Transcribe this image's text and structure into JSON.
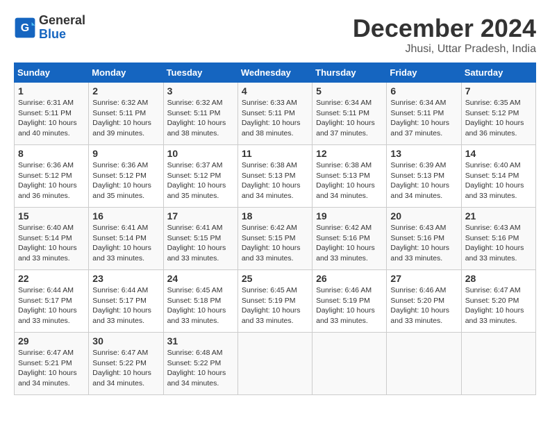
{
  "header": {
    "logo_line1": "General",
    "logo_line2": "Blue",
    "month": "December 2024",
    "location": "Jhusi, Uttar Pradesh, India"
  },
  "weekdays": [
    "Sunday",
    "Monday",
    "Tuesday",
    "Wednesday",
    "Thursday",
    "Friday",
    "Saturday"
  ],
  "weeks": [
    [
      {
        "day": "1",
        "info": "Sunrise: 6:31 AM\nSunset: 5:11 PM\nDaylight: 10 hours\nand 40 minutes."
      },
      {
        "day": "2",
        "info": "Sunrise: 6:32 AM\nSunset: 5:11 PM\nDaylight: 10 hours\nand 39 minutes."
      },
      {
        "day": "3",
        "info": "Sunrise: 6:32 AM\nSunset: 5:11 PM\nDaylight: 10 hours\nand 38 minutes."
      },
      {
        "day": "4",
        "info": "Sunrise: 6:33 AM\nSunset: 5:11 PM\nDaylight: 10 hours\nand 38 minutes."
      },
      {
        "day": "5",
        "info": "Sunrise: 6:34 AM\nSunset: 5:11 PM\nDaylight: 10 hours\nand 37 minutes."
      },
      {
        "day": "6",
        "info": "Sunrise: 6:34 AM\nSunset: 5:11 PM\nDaylight: 10 hours\nand 37 minutes."
      },
      {
        "day": "7",
        "info": "Sunrise: 6:35 AM\nSunset: 5:12 PM\nDaylight: 10 hours\nand 36 minutes."
      }
    ],
    [
      {
        "day": "8",
        "info": "Sunrise: 6:36 AM\nSunset: 5:12 PM\nDaylight: 10 hours\nand 36 minutes."
      },
      {
        "day": "9",
        "info": "Sunrise: 6:36 AM\nSunset: 5:12 PM\nDaylight: 10 hours\nand 35 minutes."
      },
      {
        "day": "10",
        "info": "Sunrise: 6:37 AM\nSunset: 5:12 PM\nDaylight: 10 hours\nand 35 minutes."
      },
      {
        "day": "11",
        "info": "Sunrise: 6:38 AM\nSunset: 5:13 PM\nDaylight: 10 hours\nand 34 minutes."
      },
      {
        "day": "12",
        "info": "Sunrise: 6:38 AM\nSunset: 5:13 PM\nDaylight: 10 hours\nand 34 minutes."
      },
      {
        "day": "13",
        "info": "Sunrise: 6:39 AM\nSunset: 5:13 PM\nDaylight: 10 hours\nand 34 minutes."
      },
      {
        "day": "14",
        "info": "Sunrise: 6:40 AM\nSunset: 5:14 PM\nDaylight: 10 hours\nand 33 minutes."
      }
    ],
    [
      {
        "day": "15",
        "info": "Sunrise: 6:40 AM\nSunset: 5:14 PM\nDaylight: 10 hours\nand 33 minutes."
      },
      {
        "day": "16",
        "info": "Sunrise: 6:41 AM\nSunset: 5:14 PM\nDaylight: 10 hours\nand 33 minutes."
      },
      {
        "day": "17",
        "info": "Sunrise: 6:41 AM\nSunset: 5:15 PM\nDaylight: 10 hours\nand 33 minutes."
      },
      {
        "day": "18",
        "info": "Sunrise: 6:42 AM\nSunset: 5:15 PM\nDaylight: 10 hours\nand 33 minutes."
      },
      {
        "day": "19",
        "info": "Sunrise: 6:42 AM\nSunset: 5:16 PM\nDaylight: 10 hours\nand 33 minutes."
      },
      {
        "day": "20",
        "info": "Sunrise: 6:43 AM\nSunset: 5:16 PM\nDaylight: 10 hours\nand 33 minutes."
      },
      {
        "day": "21",
        "info": "Sunrise: 6:43 AM\nSunset: 5:16 PM\nDaylight: 10 hours\nand 33 minutes."
      }
    ],
    [
      {
        "day": "22",
        "info": "Sunrise: 6:44 AM\nSunset: 5:17 PM\nDaylight: 10 hours\nand 33 minutes."
      },
      {
        "day": "23",
        "info": "Sunrise: 6:44 AM\nSunset: 5:17 PM\nDaylight: 10 hours\nand 33 minutes."
      },
      {
        "day": "24",
        "info": "Sunrise: 6:45 AM\nSunset: 5:18 PM\nDaylight: 10 hours\nand 33 minutes."
      },
      {
        "day": "25",
        "info": "Sunrise: 6:45 AM\nSunset: 5:19 PM\nDaylight: 10 hours\nand 33 minutes."
      },
      {
        "day": "26",
        "info": "Sunrise: 6:46 AM\nSunset: 5:19 PM\nDaylight: 10 hours\nand 33 minutes."
      },
      {
        "day": "27",
        "info": "Sunrise: 6:46 AM\nSunset: 5:20 PM\nDaylight: 10 hours\nand 33 minutes."
      },
      {
        "day": "28",
        "info": "Sunrise: 6:47 AM\nSunset: 5:20 PM\nDaylight: 10 hours\nand 33 minutes."
      }
    ],
    [
      {
        "day": "29",
        "info": "Sunrise: 6:47 AM\nSunset: 5:21 PM\nDaylight: 10 hours\nand 34 minutes."
      },
      {
        "day": "30",
        "info": "Sunrise: 6:47 AM\nSunset: 5:22 PM\nDaylight: 10 hours\nand 34 minutes."
      },
      {
        "day": "31",
        "info": "Sunrise: 6:48 AM\nSunset: 5:22 PM\nDaylight: 10 hours\nand 34 minutes."
      },
      {
        "day": "",
        "info": ""
      },
      {
        "day": "",
        "info": ""
      },
      {
        "day": "",
        "info": ""
      },
      {
        "day": "",
        "info": ""
      }
    ]
  ]
}
